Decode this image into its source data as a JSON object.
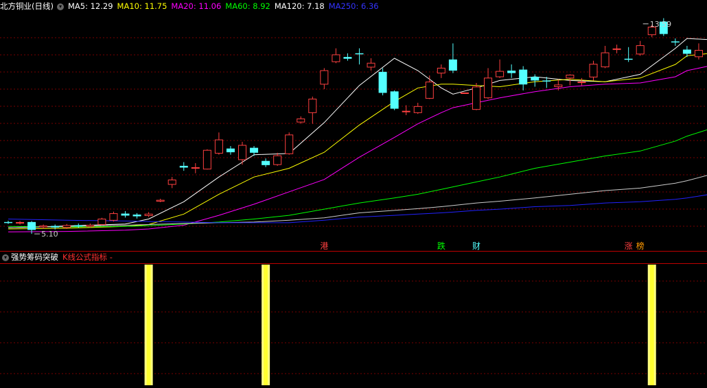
{
  "header": {
    "stock_name": "北方铜业",
    "period": "(日线)",
    "ma_labels": [
      {
        "text": "MA5: 12.29",
        "color": "#ffffff"
      },
      {
        "text": "MA10: 11.75",
        "color": "#ffff00"
      },
      {
        "text": "MA20: 11.06",
        "color": "#ff00ff"
      },
      {
        "text": "MA60: 8.92",
        "color": "#00ff00"
      },
      {
        "text": "MA120: 7.18",
        "color": "#ffffff"
      },
      {
        "text": "MA250: 6.36",
        "color": "#3333ff"
      }
    ]
  },
  "sub_panel": {
    "title": "强势筹码突破",
    "subtitle": "K线公式指标 -"
  },
  "colors": {
    "up": "#ff4040",
    "down": "#54ffff",
    "grid": "#7a0000",
    "bar": "#ffff80"
  },
  "chart_data": [
    {
      "type": "candlestick",
      "y_range": [
        4.8,
        14.0
      ],
      "annotations": [
        {
          "text": "13.59",
          "index": 54,
          "value": 13.59
        },
        {
          "text": "5.10",
          "index": 2,
          "value": 5.1
        }
      ],
      "event_markers": [
        {
          "text": "港",
          "index": 27,
          "color": "#ff4040"
        },
        {
          "text": "跌",
          "index": 37,
          "color": "#00ff00"
        },
        {
          "text": "财",
          "index": 40,
          "color": "#54ffff"
        },
        {
          "text": "涨",
          "index": 53,
          "color": "#ff4040"
        },
        {
          "text": "榜",
          "index": 54,
          "color": "#ff9900"
        }
      ],
      "candles": [
        [
          5.58,
          5.55,
          5.63,
          5.5
        ],
        [
          5.55,
          5.56,
          5.62,
          5.48
        ],
        [
          5.58,
          5.26,
          5.62,
          5.1
        ],
        [
          5.38,
          5.42,
          5.48,
          5.3
        ],
        [
          5.42,
          5.36,
          5.48,
          5.28
        ],
        [
          5.36,
          5.44,
          5.5,
          5.3
        ],
        [
          5.45,
          5.4,
          5.52,
          5.34
        ],
        [
          5.4,
          5.45,
          5.52,
          5.34
        ],
        [
          5.48,
          5.7,
          5.75,
          5.45
        ],
        [
          5.65,
          5.92,
          6.0,
          5.6
        ],
        [
          5.92,
          5.84,
          6.02,
          5.76
        ],
        [
          5.88,
          5.81,
          5.94,
          5.72
        ],
        [
          5.84,
          5.9,
          5.98,
          5.78
        ],
        [
          6.42,
          6.46,
          6.52,
          6.38
        ],
        [
          7.1,
          7.28,
          7.4,
          6.95
        ],
        [
          7.85,
          7.78,
          8.0,
          7.65
        ],
        [
          7.75,
          7.78,
          7.96,
          7.55
        ],
        [
          7.72,
          8.48,
          8.52,
          7.7
        ],
        [
          8.36,
          8.9,
          9.2,
          8.3
        ],
        [
          8.55,
          8.4,
          8.65,
          8.3
        ],
        [
          8.1,
          8.68,
          8.82,
          7.9
        ],
        [
          8.58,
          8.38,
          8.65,
          8.25
        ],
        [
          8.05,
          7.88,
          8.15,
          7.8
        ],
        [
          7.9,
          8.26,
          8.38,
          7.85
        ],
        [
          8.34,
          9.1,
          9.2,
          8.3
        ],
        [
          9.62,
          9.75,
          9.85,
          9.55
        ],
        [
          10.0,
          10.55,
          10.65,
          9.55
        ],
        [
          11.15,
          11.7,
          11.8,
          10.95
        ],
        [
          12.06,
          12.34,
          12.6,
          12.0
        ],
        [
          12.25,
          12.18,
          12.4,
          12.1
        ],
        [
          12.4,
          12.36,
          12.6,
          11.95
        ],
        [
          11.84,
          12.0,
          12.2,
          11.7
        ],
        [
          11.65,
          10.8,
          11.8,
          10.7
        ],
        [
          10.86,
          10.16,
          10.9,
          10.1
        ],
        [
          10.04,
          10.06,
          10.3,
          9.9
        ],
        [
          10.0,
          10.25,
          10.4,
          9.95
        ],
        [
          10.58,
          11.24,
          11.5,
          10.55
        ],
        [
          11.6,
          11.8,
          11.95,
          11.4
        ],
        [
          12.15,
          11.7,
          12.8,
          11.6
        ],
        [
          10.8,
          10.8,
          10.8,
          10.8
        ],
        [
          10.13,
          11.04,
          11.2,
          10.1
        ],
        [
          10.6,
          11.4,
          11.8,
          10.55
        ],
        [
          11.45,
          11.67,
          12.15,
          11.4
        ],
        [
          11.7,
          11.6,
          11.95,
          11.4
        ],
        [
          11.74,
          11.14,
          11.88,
          10.9
        ],
        [
          11.45,
          11.3,
          11.55,
          11.05
        ],
        [
          11.3,
          11.29,
          11.45,
          11.0
        ],
        [
          11.05,
          11.12,
          11.35,
          10.9
        ],
        [
          11.4,
          11.52,
          11.55,
          11.1
        ],
        [
          11.22,
          11.24,
          11.4,
          11.1
        ],
        [
          11.44,
          11.96,
          12.1,
          11.3
        ],
        [
          11.85,
          12.42,
          12.7,
          11.8
        ],
        [
          12.57,
          12.58,
          12.75,
          12.4
        ],
        [
          12.18,
          12.17,
          12.65,
          12.05
        ],
        [
          12.37,
          12.71,
          12.9,
          12.3
        ],
        [
          13.15,
          13.46,
          13.55,
          13.05
        ],
        [
          13.68,
          13.18,
          13.82,
          13.1
        ],
        [
          12.88,
          12.85,
          13.0,
          12.7
        ],
        [
          12.55,
          12.38,
          12.7,
          12.25
        ],
        [
          12.26,
          12.52,
          12.8,
          12.15
        ]
      ],
      "ma_series": [
        {
          "name": "MA5",
          "color": "#ffffff",
          "points": [
            [
              0,
              5.35
            ],
            [
              5,
              5.42
            ],
            [
              10,
              5.5
            ],
            [
              12,
              5.7
            ],
            [
              15,
              6.4
            ],
            [
              18,
              7.4
            ],
            [
              21,
              8.3
            ],
            [
              24,
              8.35
            ],
            [
              27,
              9.6
            ],
            [
              30,
              11.1
            ],
            [
              33,
              12.2
            ],
            [
              35,
              11.7
            ],
            [
              37,
              11.0
            ],
            [
              38,
              10.75
            ],
            [
              40,
              11.0
            ],
            [
              42,
              11.3
            ],
            [
              45,
              11.45
            ],
            [
              48,
              11.3
            ],
            [
              51,
              11.25
            ],
            [
              54,
              11.55
            ],
            [
              57,
              12.6
            ],
            [
              58,
              13.0
            ],
            [
              60,
              12.95
            ]
          ]
        },
        {
          "name": "MA10",
          "color": "#ffff00",
          "points": [
            [
              0,
              5.3
            ],
            [
              5,
              5.33
            ],
            [
              10,
              5.4
            ],
            [
              12,
              5.48
            ],
            [
              15,
              5.9
            ],
            [
              18,
              6.7
            ],
            [
              21,
              7.4
            ],
            [
              24,
              7.75
            ],
            [
              27,
              8.4
            ],
            [
              30,
              9.5
            ],
            [
              33,
              10.45
            ],
            [
              35,
              11.0
            ],
            [
              37,
              11.15
            ],
            [
              38,
              11.15
            ],
            [
              40,
              11.1
            ],
            [
              42,
              11.05
            ],
            [
              45,
              11.25
            ],
            [
              48,
              11.35
            ],
            [
              51,
              11.25
            ],
            [
              54,
              11.4
            ],
            [
              57,
              11.95
            ],
            [
              58,
              12.3
            ],
            [
              60,
              12.4
            ]
          ]
        },
        {
          "name": "MA20",
          "color": "#ff00ff",
          "points": [
            [
              0,
              5.18
            ],
            [
              5,
              5.2
            ],
            [
              10,
              5.25
            ],
            [
              12,
              5.3
            ],
            [
              15,
              5.45
            ],
            [
              18,
              5.85
            ],
            [
              21,
              6.3
            ],
            [
              24,
              6.8
            ],
            [
              27,
              7.3
            ],
            [
              30,
              8.2
            ],
            [
              33,
              9.0
            ],
            [
              35,
              9.55
            ],
            [
              37,
              10.0
            ],
            [
              38,
              10.2
            ],
            [
              40,
              10.4
            ],
            [
              42,
              10.6
            ],
            [
              45,
              10.85
            ],
            [
              48,
              11.05
            ],
            [
              51,
              11.15
            ],
            [
              54,
              11.2
            ],
            [
              57,
              11.45
            ],
            [
              58,
              11.7
            ],
            [
              60,
              11.9
            ]
          ]
        },
        {
          "name": "MA60",
          "color": "#00ff00",
          "points": [
            [
              0,
              5.4
            ],
            [
              5,
              5.38
            ],
            [
              10,
              5.4
            ],
            [
              12,
              5.43
            ],
            [
              15,
              5.5
            ],
            [
              18,
              5.58
            ],
            [
              21,
              5.7
            ],
            [
              24,
              5.85
            ],
            [
              27,
              6.1
            ],
            [
              30,
              6.35
            ],
            [
              33,
              6.55
            ],
            [
              35,
              6.7
            ],
            [
              37,
              6.9
            ],
            [
              38,
              7.0
            ],
            [
              40,
              7.2
            ],
            [
              42,
              7.4
            ],
            [
              45,
              7.75
            ],
            [
              48,
              8.0
            ],
            [
              51,
              8.25
            ],
            [
              54,
              8.45
            ],
            [
              57,
              8.85
            ],
            [
              58,
              9.05
            ],
            [
              60,
              9.35
            ]
          ]
        },
        {
          "name": "MA120",
          "color": "#cccccc",
          "points": [
            [
              0,
              5.35
            ],
            [
              5,
              5.4
            ],
            [
              10,
              5.45
            ],
            [
              12,
              5.48
            ],
            [
              15,
              5.52
            ],
            [
              18,
              5.55
            ],
            [
              21,
              5.58
            ],
            [
              24,
              5.65
            ],
            [
              27,
              5.75
            ],
            [
              30,
              5.95
            ],
            [
              33,
              6.05
            ],
            [
              35,
              6.12
            ],
            [
              37,
              6.2
            ],
            [
              38,
              6.25
            ],
            [
              40,
              6.35
            ],
            [
              42,
              6.42
            ],
            [
              45,
              6.55
            ],
            [
              48,
              6.7
            ],
            [
              51,
              6.85
            ],
            [
              54,
              6.95
            ],
            [
              57,
              7.15
            ],
            [
              58,
              7.25
            ],
            [
              60,
              7.5
            ]
          ]
        },
        {
          "name": "MA250",
          "color": "#2222ff",
          "points": [
            [
              0,
              5.7
            ],
            [
              5,
              5.65
            ],
            [
              10,
              5.62
            ],
            [
              12,
              5.6
            ],
            [
              15,
              5.58
            ],
            [
              18,
              5.55
            ],
            [
              21,
              5.55
            ],
            [
              24,
              5.55
            ],
            [
              27,
              5.65
            ],
            [
              30,
              5.78
            ],
            [
              33,
              5.85
            ],
            [
              35,
              5.9
            ],
            [
              37,
              5.95
            ],
            [
              38,
              5.98
            ],
            [
              40,
              6.05
            ],
            [
              42,
              6.1
            ],
            [
              45,
              6.2
            ],
            [
              48,
              6.25
            ],
            [
              51,
              6.35
            ],
            [
              54,
              6.4
            ],
            [
              57,
              6.5
            ],
            [
              58,
              6.55
            ],
            [
              60,
              6.7
            ]
          ]
        }
      ]
    },
    {
      "type": "bar",
      "name": "强势筹码突破",
      "signal_indices": [
        12,
        22,
        55
      ],
      "values": [
        1,
        1,
        1
      ]
    }
  ]
}
